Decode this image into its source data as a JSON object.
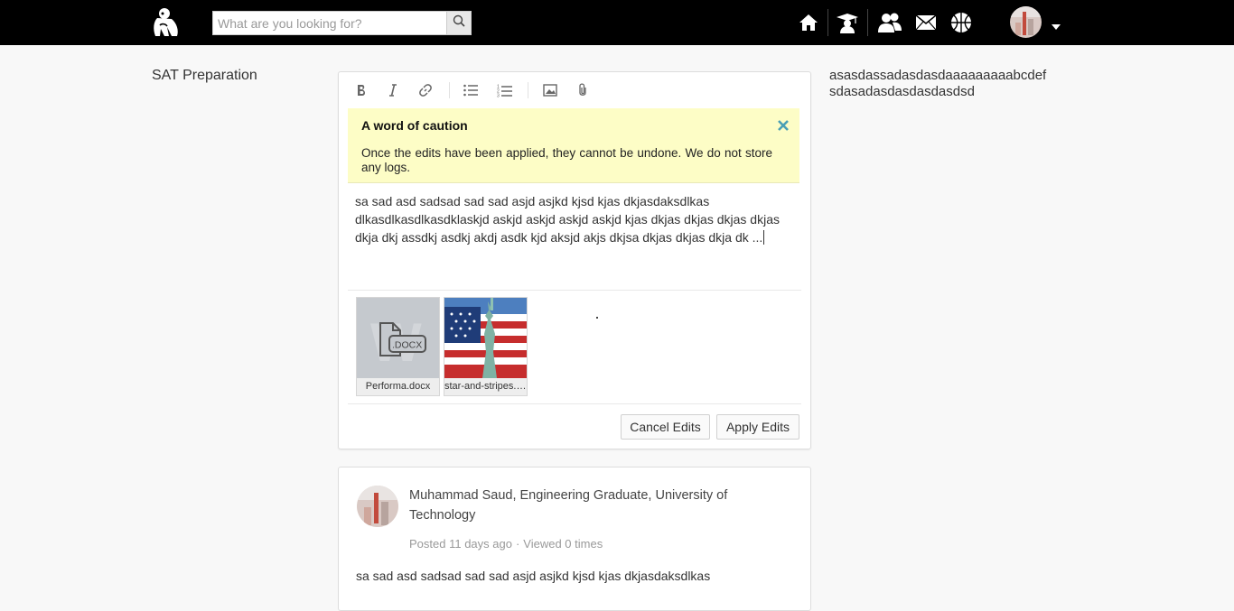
{
  "header": {
    "search_placeholder": "What are you looking for?",
    "icons": [
      "logo-icon",
      "search-icon",
      "home-icon",
      "graduate-icon",
      "people-icon",
      "mail-icon",
      "basketball-icon",
      "chevron-down-icon"
    ]
  },
  "left": {
    "title": "SAT Preparation"
  },
  "right": {
    "lines": [
      "asasdassadasdasdaaaaaaaaabcdef",
      "sdasadasdasdasdasdsd"
    ]
  },
  "editor": {
    "caution": {
      "title": "A word of caution",
      "body": "Once the edits have been applied, they cannot be undone. We do not store any logs."
    },
    "content": "sa sad asd sadsad sad sad asjd asjkd kjsd kjas dkjasdaksdlkas dlkasdlkasdlkasdklaskjd askjd askjd askjd askjd kjas dkjas dkjas dkjas dkjas dkja dkj assdkj asdkj akdj asdk kjd aksjd akjs dkjsa dkjas dkjas dkja dk ...",
    "attachments": [
      {
        "label": "Performa.docx",
        "type": ".DOCX"
      },
      {
        "label": "star-and-stripes.jpg"
      }
    ],
    "cancel_label": "Cancel Edits",
    "apply_label": "Apply Edits"
  },
  "post": {
    "author": "Muhammad Saud",
    "role": "Engineering Graduate",
    "org": "University of Technology",
    "posted": "Posted 11 days ago",
    "separator": "·",
    "views": "Viewed 0 times",
    "body": "sa sad asd sadsad sad sad asjd asjkd kjsd kjas dkjasdaksdlkas"
  },
  "colors": {
    "topbar": "#000000",
    "caution_bg": "#fdfdc6",
    "close_x": "#4a9fb5"
  }
}
